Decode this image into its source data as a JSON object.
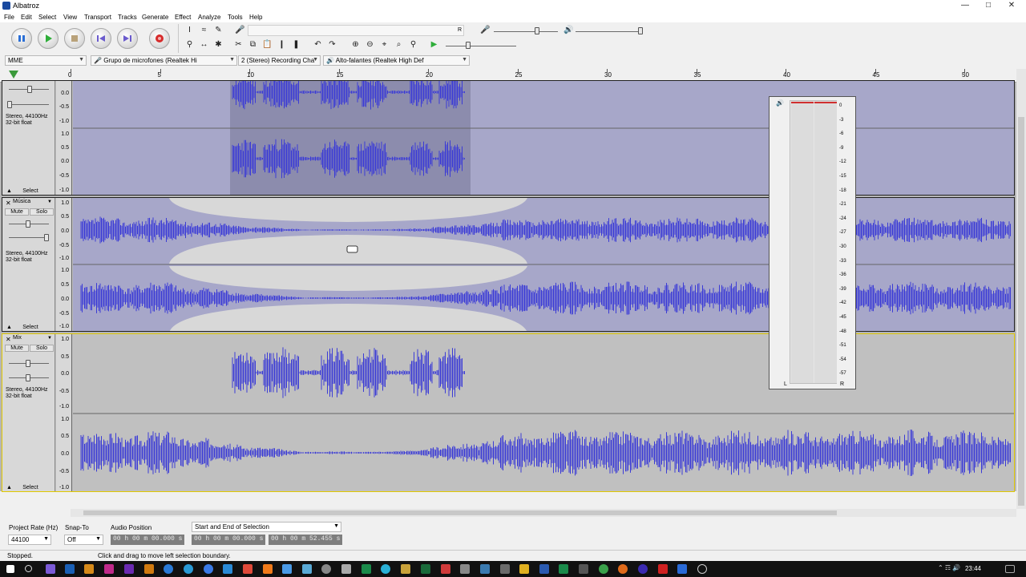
{
  "window": {
    "title": "Albatroz"
  },
  "menu": [
    "File",
    "Edit",
    "Select",
    "View",
    "Transport",
    "Tracks",
    "Generate",
    "Effect",
    "Analyze",
    "Tools",
    "Help"
  ],
  "meters": {
    "record_label": "R",
    "channels_label": "R"
  },
  "devices": {
    "host": "MME",
    "mic": "Grupo de microfones (Realtek Hi",
    "channels": "2 (Stereo) Recording Cha",
    "output": "Alto-falantes (Realtek High Def"
  },
  "ruler": {
    "ticks": [
      "0",
      "5",
      "10",
      "15",
      "20",
      "25",
      "30",
      "35",
      "40",
      "45",
      "50"
    ]
  },
  "tracks": [
    {
      "name": "",
      "format": "Stereo, 44100Hz",
      "bits": "32-bit float",
      "mute": "Mute",
      "solo": "Solo",
      "select": "Select",
      "channel1_labels": [
        "0.0",
        "-0.5",
        "-1.0"
      ],
      "channel2_labels": [
        "1.0",
        "0.5",
        "0.0",
        "-0.5",
        "-1.0"
      ]
    },
    {
      "name": "Música",
      "format": "Stereo, 44100Hz",
      "bits": "32-bit float",
      "mute": "Mute",
      "solo": "Solo",
      "select": "Select",
      "channel1_labels": [
        "1.0",
        "0.5",
        "0.0",
        "-0.5",
        "-1.0"
      ],
      "channel2_labels": [
        "1.0",
        "0.5",
        "0.0",
        "-0.5",
        "-1.0"
      ]
    },
    {
      "name": "Mix",
      "format": "Stereo, 44100Hz",
      "bits": "32-bit float",
      "mute": "Mute",
      "solo": "Solo",
      "select": "Select",
      "channel1_labels": [
        "1.0",
        "0.5",
        "0.0",
        "-0.5",
        "-1.0"
      ],
      "channel2_labels": [
        "1.0",
        "0.5",
        "0.0",
        "-0.5",
        "-1.0"
      ]
    }
  ],
  "meter_window": {
    "scale": [
      "0",
      "-3",
      "-6",
      "-9",
      "-12",
      "-15",
      "-18",
      "-21",
      "-24",
      "-27",
      "-30",
      "-33",
      "-36",
      "-39",
      "-42",
      "-45",
      "-48",
      "-51",
      "-54",
      "-57"
    ],
    "left": "L",
    "right": "R"
  },
  "selection_toolbar": {
    "project_rate_label": "Project Rate (Hz)",
    "project_rate": "44100",
    "snap_label": "Snap-To",
    "snap_value": "Off",
    "audio_position_label": "Audio Position",
    "audio_position": "00 h 00 m 00.000 s",
    "selection_mode": "Start and End of Selection",
    "selection_start": "00 h 00 m 00.000 s",
    "selection_end": "00 h 00 m 52.455 s"
  },
  "status": {
    "state": "Stopped.",
    "hint": "Click and drag to move left selection boundary."
  },
  "taskbar": {
    "time": "23:44"
  }
}
